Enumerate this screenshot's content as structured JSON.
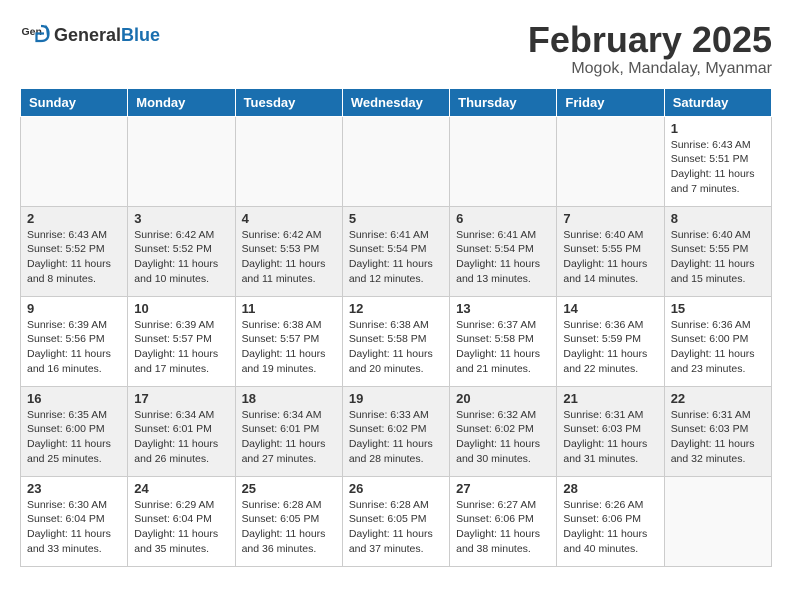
{
  "logo": {
    "text_general": "General",
    "text_blue": "Blue"
  },
  "header": {
    "month_year": "February 2025",
    "location": "Mogok, Mandalay, Myanmar"
  },
  "weekdays": [
    "Sunday",
    "Monday",
    "Tuesday",
    "Wednesday",
    "Thursday",
    "Friday",
    "Saturday"
  ],
  "weeks": [
    [
      {
        "day": "",
        "info": ""
      },
      {
        "day": "",
        "info": ""
      },
      {
        "day": "",
        "info": ""
      },
      {
        "day": "",
        "info": ""
      },
      {
        "day": "",
        "info": ""
      },
      {
        "day": "",
        "info": ""
      },
      {
        "day": "1",
        "info": "Sunrise: 6:43 AM\nSunset: 5:51 PM\nDaylight: 11 hours and 7 minutes."
      }
    ],
    [
      {
        "day": "2",
        "info": "Sunrise: 6:43 AM\nSunset: 5:52 PM\nDaylight: 11 hours and 8 minutes."
      },
      {
        "day": "3",
        "info": "Sunrise: 6:42 AM\nSunset: 5:52 PM\nDaylight: 11 hours and 10 minutes."
      },
      {
        "day": "4",
        "info": "Sunrise: 6:42 AM\nSunset: 5:53 PM\nDaylight: 11 hours and 11 minutes."
      },
      {
        "day": "5",
        "info": "Sunrise: 6:41 AM\nSunset: 5:54 PM\nDaylight: 11 hours and 12 minutes."
      },
      {
        "day": "6",
        "info": "Sunrise: 6:41 AM\nSunset: 5:54 PM\nDaylight: 11 hours and 13 minutes."
      },
      {
        "day": "7",
        "info": "Sunrise: 6:40 AM\nSunset: 5:55 PM\nDaylight: 11 hours and 14 minutes."
      },
      {
        "day": "8",
        "info": "Sunrise: 6:40 AM\nSunset: 5:55 PM\nDaylight: 11 hours and 15 minutes."
      }
    ],
    [
      {
        "day": "9",
        "info": "Sunrise: 6:39 AM\nSunset: 5:56 PM\nDaylight: 11 hours and 16 minutes."
      },
      {
        "day": "10",
        "info": "Sunrise: 6:39 AM\nSunset: 5:57 PM\nDaylight: 11 hours and 17 minutes."
      },
      {
        "day": "11",
        "info": "Sunrise: 6:38 AM\nSunset: 5:57 PM\nDaylight: 11 hours and 19 minutes."
      },
      {
        "day": "12",
        "info": "Sunrise: 6:38 AM\nSunset: 5:58 PM\nDaylight: 11 hours and 20 minutes."
      },
      {
        "day": "13",
        "info": "Sunrise: 6:37 AM\nSunset: 5:58 PM\nDaylight: 11 hours and 21 minutes."
      },
      {
        "day": "14",
        "info": "Sunrise: 6:36 AM\nSunset: 5:59 PM\nDaylight: 11 hours and 22 minutes."
      },
      {
        "day": "15",
        "info": "Sunrise: 6:36 AM\nSunset: 6:00 PM\nDaylight: 11 hours and 23 minutes."
      }
    ],
    [
      {
        "day": "16",
        "info": "Sunrise: 6:35 AM\nSunset: 6:00 PM\nDaylight: 11 hours and 25 minutes."
      },
      {
        "day": "17",
        "info": "Sunrise: 6:34 AM\nSunset: 6:01 PM\nDaylight: 11 hours and 26 minutes."
      },
      {
        "day": "18",
        "info": "Sunrise: 6:34 AM\nSunset: 6:01 PM\nDaylight: 11 hours and 27 minutes."
      },
      {
        "day": "19",
        "info": "Sunrise: 6:33 AM\nSunset: 6:02 PM\nDaylight: 11 hours and 28 minutes."
      },
      {
        "day": "20",
        "info": "Sunrise: 6:32 AM\nSunset: 6:02 PM\nDaylight: 11 hours and 30 minutes."
      },
      {
        "day": "21",
        "info": "Sunrise: 6:31 AM\nSunset: 6:03 PM\nDaylight: 11 hours and 31 minutes."
      },
      {
        "day": "22",
        "info": "Sunrise: 6:31 AM\nSunset: 6:03 PM\nDaylight: 11 hours and 32 minutes."
      }
    ],
    [
      {
        "day": "23",
        "info": "Sunrise: 6:30 AM\nSunset: 6:04 PM\nDaylight: 11 hours and 33 minutes."
      },
      {
        "day": "24",
        "info": "Sunrise: 6:29 AM\nSunset: 6:04 PM\nDaylight: 11 hours and 35 minutes."
      },
      {
        "day": "25",
        "info": "Sunrise: 6:28 AM\nSunset: 6:05 PM\nDaylight: 11 hours and 36 minutes."
      },
      {
        "day": "26",
        "info": "Sunrise: 6:28 AM\nSunset: 6:05 PM\nDaylight: 11 hours and 37 minutes."
      },
      {
        "day": "27",
        "info": "Sunrise: 6:27 AM\nSunset: 6:06 PM\nDaylight: 11 hours and 38 minutes."
      },
      {
        "day": "28",
        "info": "Sunrise: 6:26 AM\nSunset: 6:06 PM\nDaylight: 11 hours and 40 minutes."
      },
      {
        "day": "",
        "info": ""
      }
    ]
  ]
}
